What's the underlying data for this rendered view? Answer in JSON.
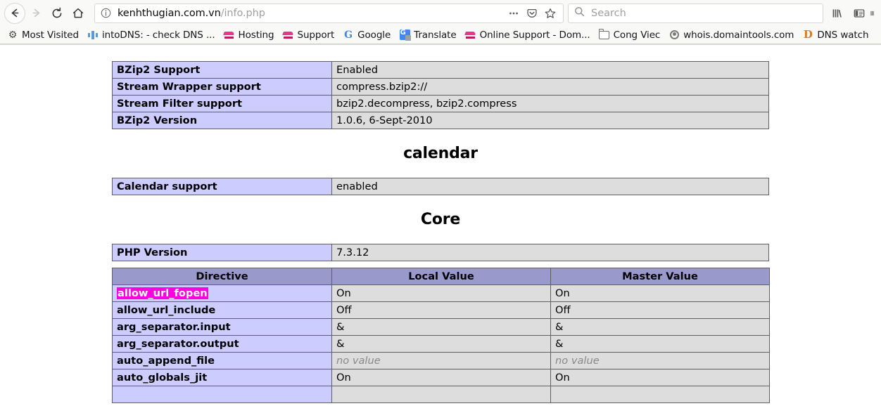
{
  "browser": {
    "nav": {
      "back_label": "Back",
      "forward_label": "Forward",
      "reload_label": "Reload",
      "home_label": "Home"
    },
    "url": {
      "host": "kenhthugian.com.vn",
      "path": "/info.php",
      "identity_icon": "info-circle-icon"
    },
    "url_actions": {
      "page_actions_label": "•••",
      "pocket_label": "Save to Pocket",
      "bookmark_label": "Bookmark this page"
    },
    "search": {
      "placeholder": "Search"
    },
    "toolbar_right": [
      {
        "name": "library-icon",
        "label": "Library"
      },
      {
        "name": "sidebar-icon",
        "label": "Sidebars"
      },
      {
        "name": "menu-icon",
        "label": "Open menu"
      }
    ],
    "bookmarks": [
      {
        "label": "Most Visited",
        "icon": "star-gear-icon",
        "fav": "fav-gear"
      },
      {
        "label": "intoDNS: - check DNS ...",
        "icon": "intodns-icon",
        "fav": "fav-dns"
      },
      {
        "label": "Hosting",
        "icon": "hosting-icon",
        "fav": "fav-pink"
      },
      {
        "label": "Support",
        "icon": "support-icon",
        "fav": "fav-pink"
      },
      {
        "label": "Google",
        "icon": "google-icon",
        "fav": "fav-google"
      },
      {
        "label": "Translate",
        "icon": "google-translate-icon",
        "fav": "fav-translate"
      },
      {
        "label": "Online Support - Dom...",
        "icon": "online-support-icon",
        "fav": "fav-pink"
      },
      {
        "label": "Cong Viec",
        "icon": "folder-icon",
        "fav": "fav-folder"
      },
      {
        "label": "whois.domaintools.com",
        "icon": "whois-icon",
        "fav": "fav-whois"
      },
      {
        "label": "DNS watch",
        "icon": "dnswatch-icon",
        "fav": "fav-dnswatch"
      }
    ]
  },
  "page": {
    "bzip2_table": {
      "rows": [
        {
          "name": "BZip2 Support",
          "value": "Enabled"
        },
        {
          "name": "Stream Wrapper support",
          "value": "compress.bzip2://"
        },
        {
          "name": "Stream Filter support",
          "value": "bzip2.decompress, bzip2.compress"
        },
        {
          "name": "BZip2 Version",
          "value": "1.0.6, 6-Sept-2010"
        }
      ]
    },
    "calendar_heading": "calendar",
    "calendar_table": {
      "rows": [
        {
          "name": "Calendar support",
          "value": "enabled"
        }
      ]
    },
    "core_heading": "Core",
    "core_version_table": {
      "rows": [
        {
          "name": "PHP Version",
          "value": "7.3.12"
        }
      ]
    },
    "directives_table": {
      "headers": {
        "directive": "Directive",
        "local_value": "Local Value",
        "master_value": "Master Value"
      },
      "rows": [
        {
          "directive": "allow_url_fopen",
          "highlight": "allow_url_fopen",
          "local": "On",
          "master": "On",
          "local_novalue": false,
          "master_novalue": false
        },
        {
          "directive": "allow_url_include",
          "highlight": "",
          "local": "Off",
          "master": "Off",
          "local_novalue": false,
          "master_novalue": false
        },
        {
          "directive": "arg_separator.input",
          "highlight": "",
          "local": "&",
          "master": "&",
          "local_novalue": false,
          "master_novalue": false
        },
        {
          "directive": "arg_separator.output",
          "highlight": "",
          "local": "&",
          "master": "&",
          "local_novalue": false,
          "master_novalue": false
        },
        {
          "directive": "auto_append_file",
          "highlight": "",
          "local": "no value",
          "master": "no value",
          "local_novalue": true,
          "master_novalue": true
        },
        {
          "directive": "auto_globals_jit",
          "highlight": "",
          "local": "On",
          "master": "On",
          "local_novalue": false,
          "master_novalue": false
        },
        {
          "directive": "",
          "highlight": "",
          "local": "",
          "master": "",
          "local_novalue": false,
          "master_novalue": false
        }
      ]
    }
  },
  "colors": {
    "table_key_bg": "#ccccff",
    "table_value_bg": "#dddddd",
    "table_header_bg": "#9999cc",
    "find_highlight_bg": "#ff00e0",
    "border": "#606060"
  }
}
